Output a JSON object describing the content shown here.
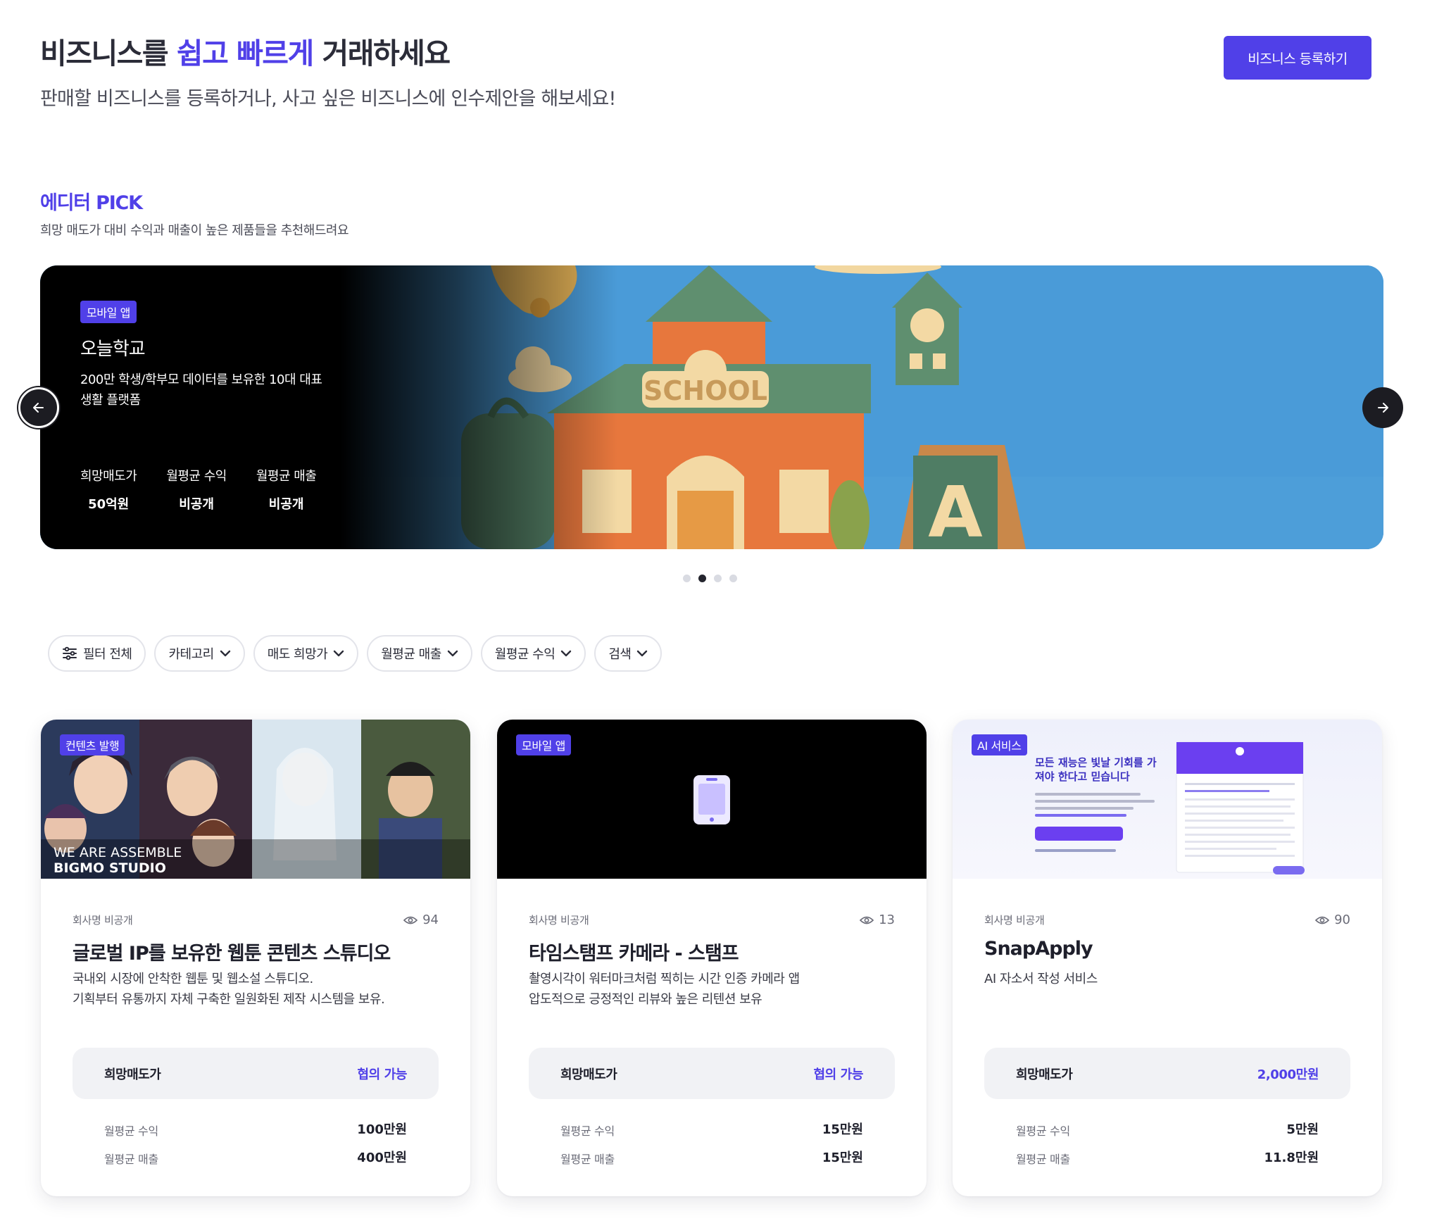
{
  "hero": {
    "title_part1": "비즈니스를 ",
    "title_accent": "쉽고 빠르게",
    "title_part2": " 거래하세요",
    "subtitle": "판매할 비즈니스를 등록하거나, 사고 싶은 비즈니스에 인수제안을 해보세요!",
    "register_button": "비즈니스 등록하기"
  },
  "editor_pick": {
    "title": "에디터 PICK",
    "subtitle": "희망 매도가 대비 수익과 매출이 높은 제품들을 추천해드려요"
  },
  "banner": {
    "badge": "모바일 앱",
    "name": "오늘학교",
    "description": "200만 학생/학부모 데이터를 보유한 10대 대표 생활 플랫폼",
    "image_sign": "SCHOOL",
    "image_letter": "A",
    "stats": [
      {
        "label": "희망매도가",
        "value": "50억원"
      },
      {
        "label": "월평균 수익",
        "value": "비공개"
      },
      {
        "label": "월평균 매출",
        "value": "비공개"
      }
    ],
    "prev_icon": "arrow-left-icon",
    "next_icon": "arrow-right-icon",
    "dot_count": 4,
    "active_dot": 1
  },
  "filters": [
    {
      "label": "필터 전체",
      "icon": "sliders-icon"
    },
    {
      "label": "카테고리",
      "icon": "chevron-down-icon"
    },
    {
      "label": "매도 희망가",
      "icon": "chevron-down-icon"
    },
    {
      "label": "월평균 매출",
      "icon": "chevron-down-icon"
    },
    {
      "label": "월평균 수익",
      "icon": "chevron-down-icon"
    },
    {
      "label": "검색",
      "icon": "chevron-down-icon"
    }
  ],
  "cards": [
    {
      "badge": "컨텐츠 발행",
      "thumb_caption_line1": "WE ARE ASSEMBLE",
      "thumb_caption_line2": "BIGMO STUDIO",
      "company": "회사명 비공개",
      "views": "94",
      "title": "글로벌 IP를 보유한 웹툰 콘텐츠 스튜디오",
      "desc_line1": "국내외 시장에 안착한 웹툰 및 웹소설 스튜디오.",
      "desc_line2": "기획부터 유통까지 자체 구축한 일원화된 제작 시스템을 보유.",
      "price_label": "희망매도가",
      "price_value": "협의 가능",
      "profit_label": "월평균 수익",
      "profit_value": "100만원",
      "revenue_label": "월평균 매출",
      "revenue_value": "400만원"
    },
    {
      "badge": "모바일 앱",
      "company": "회사명 비공개",
      "views": "13",
      "title": "타임스탬프 카메라 - 스탬프",
      "desc_line1": "촬영시각이 워터마크처럼 찍히는 시간 인증 카메라 앱",
      "desc_line2": "압도적으로 긍정적인 리뷰와 높은 리텐션 보유",
      "price_label": "희망매도가",
      "price_value": "협의 가능",
      "profit_label": "월평균 수익",
      "profit_value": "15만원",
      "revenue_label": "월평균 매출",
      "revenue_value": "15만원"
    },
    {
      "badge": "AI 서비스",
      "thumb_headline_line1": "모든 재능은 빛날 기회를 가",
      "thumb_headline_line2": "져야 한다고 믿습니다",
      "company": "회사명 비공개",
      "views": "90",
      "title": "SnapApply",
      "desc_line1": "AI 자소서 작성 서비스",
      "desc_line2": "",
      "price_label": "희망매도가",
      "price_value": "2,000만원",
      "profit_label": "월평균 수익",
      "profit_value": "5만원",
      "revenue_label": "월평균 매출",
      "revenue_value": "11.8만원"
    }
  ],
  "colors": {
    "accent": "#5040e8",
    "banner_sky": "#4a9bd8",
    "text_primary": "#1e1f2b",
    "text_secondary": "#6b6c78",
    "price_box": "#f1f2f5"
  }
}
